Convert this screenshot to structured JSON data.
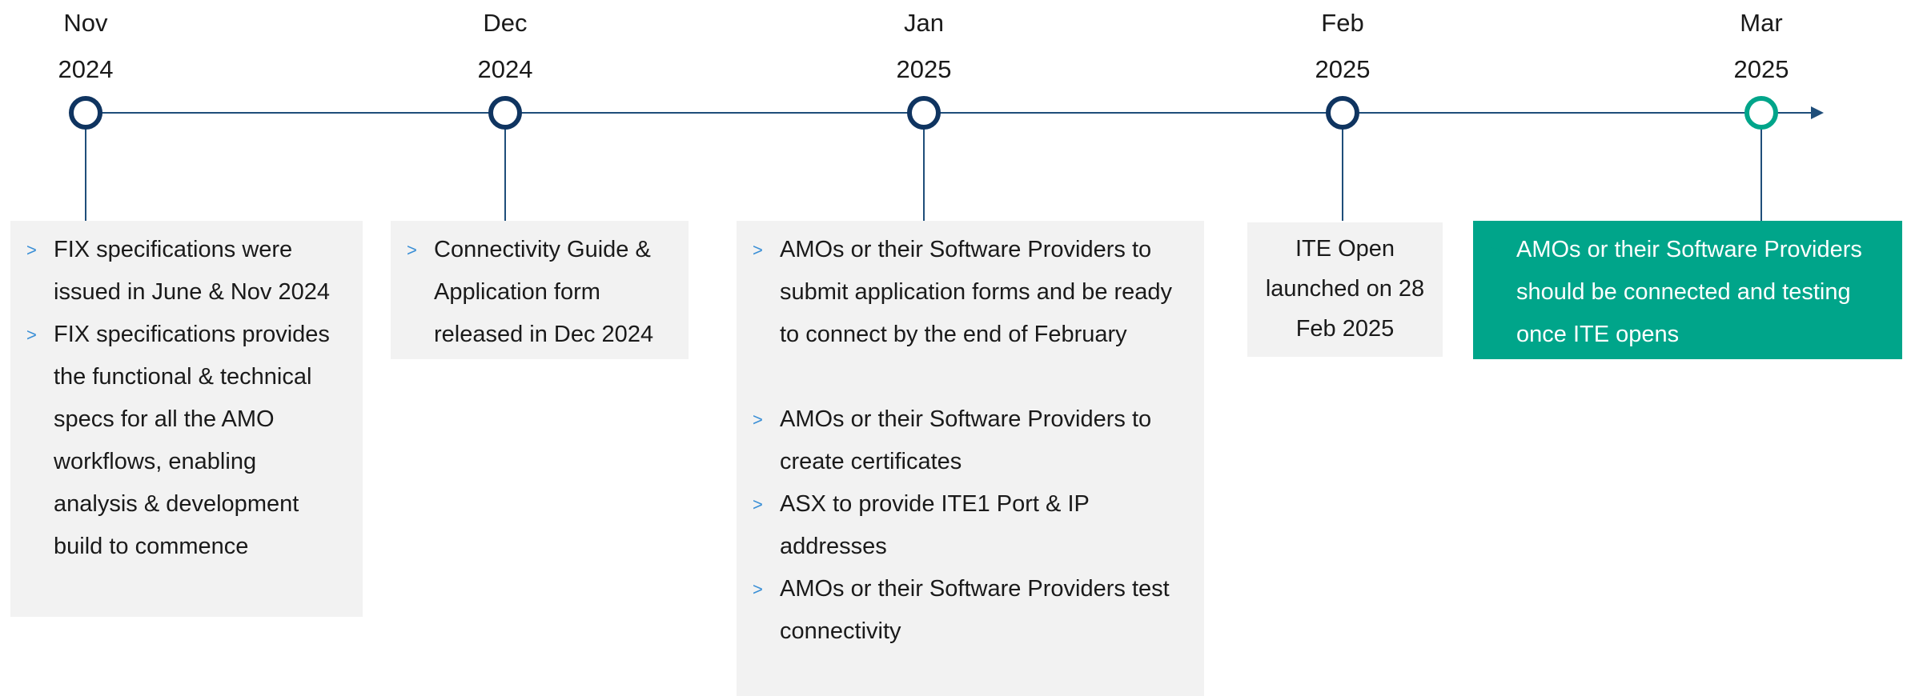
{
  "timeline": {
    "colors": {
      "line": "#1f4e7a",
      "circle": "#0f3460",
      "accent": "#00a58a",
      "box_bg": "#f2f2f2",
      "bullet": "#3a8fd6"
    },
    "milestones": [
      {
        "month": "Nov",
        "year": "2024"
      },
      {
        "month": "Dec",
        "year": "2024"
      },
      {
        "month": "Jan",
        "year": "2025"
      },
      {
        "month": "Feb",
        "year": "2025"
      },
      {
        "month": "Mar",
        "year": "2025"
      }
    ],
    "boxes": [
      {
        "bullets": [
          "FIX specifications were issued in June & Nov 2024",
          "FIX specifications provides the functional & technical specs for all the AMO workflows, enabling analysis & development build to commence"
        ]
      },
      {
        "bullets": [
          "Connectivity Guide & Application form released in Dec 2024"
        ]
      },
      {
        "bullets": [
          "AMOs or their Software Providers to submit application forms and be ready to connect by the end of February",
          "AMOs or their Software Providers to create certificates",
          "ASX to provide ITE1 Port & IP addresses",
          "AMOs or their Software Providers test connectivity"
        ]
      },
      {
        "text": "ITE Open launched on 28 Feb 2025"
      },
      {
        "bullets": [
          "AMOs or their Software Providers should be connected and testing once ITE opens"
        ]
      }
    ]
  }
}
